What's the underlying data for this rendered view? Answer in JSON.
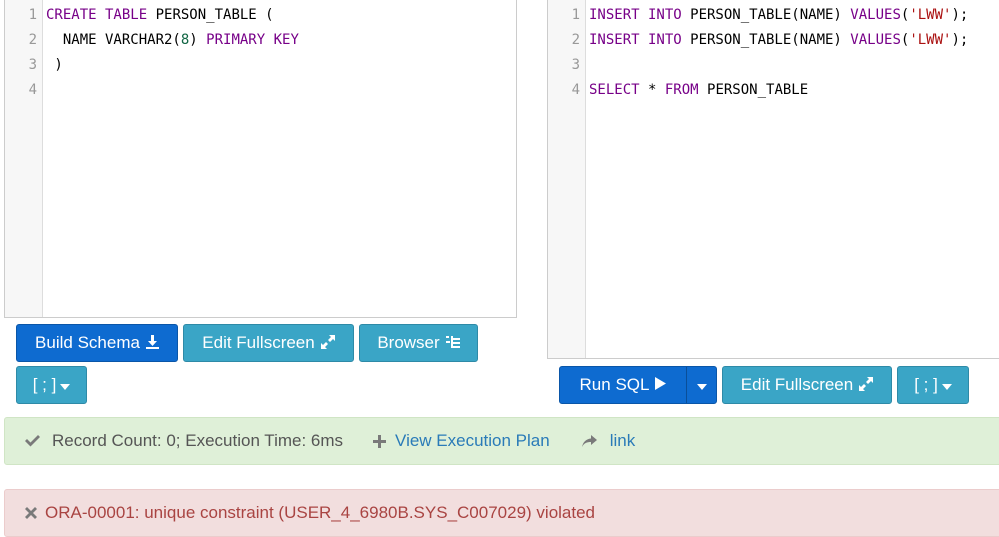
{
  "schema_panel": {
    "lines": [
      {
        "num": "1",
        "tokens": [
          {
            "t": "CREATE TABLE",
            "c": "kw"
          },
          {
            "t": " PERSON_TABLE (",
            "c": ""
          }
        ]
      },
      {
        "num": "2",
        "tokens": [
          {
            "t": "  NAME VARCHAR2(",
            "c": ""
          },
          {
            "t": "8",
            "c": "num"
          },
          {
            "t": ") ",
            "c": ""
          },
          {
            "t": "PRIMARY KEY",
            "c": "kw"
          }
        ]
      },
      {
        "num": "3",
        "tokens": [
          {
            "t": " )",
            "c": ""
          }
        ]
      },
      {
        "num": "4",
        "tokens": []
      }
    ]
  },
  "query_panel": {
    "lines": [
      {
        "num": "1",
        "tokens": [
          {
            "t": "INSERT INTO",
            "c": "kw"
          },
          {
            "t": " PERSON_TABLE(NAME) ",
            "c": ""
          },
          {
            "t": "VALUES",
            "c": "kw"
          },
          {
            "t": "(",
            "c": ""
          },
          {
            "t": "'LWW'",
            "c": "str"
          },
          {
            "t": ");",
            "c": ""
          }
        ]
      },
      {
        "num": "2",
        "tokens": [
          {
            "t": "INSERT INTO",
            "c": "kw"
          },
          {
            "t": " PERSON_TABLE(NAME) ",
            "c": ""
          },
          {
            "t": "VALUES",
            "c": "kw"
          },
          {
            "t": "(",
            "c": ""
          },
          {
            "t": "'LWW'",
            "c": "str"
          },
          {
            "t": ");",
            "c": ""
          }
        ]
      },
      {
        "num": "3",
        "tokens": []
      },
      {
        "num": "4",
        "tokens": [
          {
            "t": "SELECT",
            "c": "kw"
          },
          {
            "t": " * ",
            "c": ""
          },
          {
            "t": "FROM",
            "c": "kw"
          },
          {
            "t": " PERSON_TABLE",
            "c": ""
          }
        ]
      }
    ]
  },
  "schema_toolbar": {
    "build_schema": "Build Schema",
    "edit_fullscreen": "Edit Fullscreen",
    "browser": "Browser",
    "delimiter": "[ ; ]"
  },
  "query_toolbar": {
    "run_sql": "Run SQL",
    "edit_fullscreen": "Edit Fullscreen",
    "delimiter": "[ ; ]"
  },
  "result": {
    "summary": "Record Count: 0; Execution Time: 6ms",
    "view_plan": "View Execution Plan",
    "link": "link"
  },
  "error": {
    "message": "ORA-00001: unique constraint (USER_4_6980B.SYS_C007029) violated"
  },
  "icons": {
    "download": "download-icon",
    "expand": "expand-icon",
    "browser": "list-tree-icon",
    "caret": "caret-down-icon",
    "play": "play-icon",
    "check": "check-icon",
    "plus": "plus-icon",
    "share": "share-icon",
    "close": "close-icon"
  },
  "colors": {
    "primary": "#0e6bd0",
    "info": "#3aa5c6",
    "success_bg": "#dff0d8",
    "danger_bg": "#f2dede",
    "keyword": "#770088",
    "string": "#aa1111"
  }
}
